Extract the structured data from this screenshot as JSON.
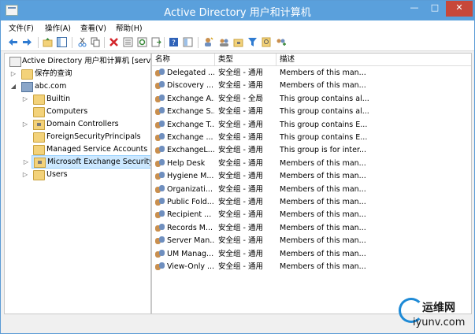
{
  "window": {
    "title": "Active Directory 用户和计算机",
    "controls": {
      "minimize": "—",
      "maximize": "□",
      "close": "✕"
    }
  },
  "menubar": {
    "items": [
      "文件(F)",
      "操作(A)",
      "查看(V)",
      "帮助(H)"
    ]
  },
  "toolbar": {
    "icons": [
      "back-icon",
      "forward-icon",
      "up-level-icon",
      "show-console-tree-icon",
      "cut-icon",
      "copy-icon",
      "delete-icon",
      "properties-icon",
      "refresh-icon",
      "export-list-icon",
      "help-icon",
      "help-topics-icon",
      "new-user-icon",
      "new-group-icon",
      "new-ou-icon",
      "filter-icon",
      "find-icon",
      "add-to-group-icon"
    ],
    "colors": {
      "nav_arrow": "#2f7bd1",
      "delete": "#d3262b"
    }
  },
  "tree": {
    "items": [
      {
        "label": "Active Directory 用户和计算机 [serve",
        "icon": "aduc-icon",
        "arrow": ""
      },
      {
        "label": "保存的查询",
        "icon": "folder-icon",
        "arrow": "▷"
      },
      {
        "label": "abc.com",
        "icon": "domain-icon",
        "arrow": "◢"
      },
      {
        "label": "Builtin",
        "icon": "folder-icon",
        "arrow": "▷"
      },
      {
        "label": "Computers",
        "icon": "folder-icon",
        "arrow": ""
      },
      {
        "label": "Domain Controllers",
        "icon": "ou-icon",
        "arrow": "▷"
      },
      {
        "label": "ForeignSecurityPrincipals",
        "icon": "folder-icon",
        "arrow": ""
      },
      {
        "label": "Managed Service Accounts",
        "icon": "folder-icon",
        "arrow": ""
      },
      {
        "label": "Microsoft Exchange Security",
        "icon": "ou-icon",
        "arrow": "▷",
        "selected": true
      },
      {
        "label": "Users",
        "icon": "folder-icon",
        "arrow": "▷"
      }
    ]
  },
  "list": {
    "columns": [
      "名称",
      "类型",
      "描述"
    ],
    "rows": [
      {
        "name": "Delegated ...",
        "type": "安全组 - 通用",
        "desc": "Members of this man..."
      },
      {
        "name": "Discovery ...",
        "type": "安全组 - 通用",
        "desc": "Members of this man..."
      },
      {
        "name": "Exchange A...",
        "type": "安全组 - 全局",
        "desc": "This group contains al..."
      },
      {
        "name": "Exchange S...",
        "type": "安全组 - 通用",
        "desc": "This group contains al..."
      },
      {
        "name": "Exchange T...",
        "type": "安全组 - 通用",
        "desc": "This group contains E..."
      },
      {
        "name": "Exchange ...",
        "type": "安全组 - 通用",
        "desc": "This group contains E..."
      },
      {
        "name": "ExchangeL...",
        "type": "安全组 - 通用",
        "desc": "This group is for inter..."
      },
      {
        "name": "Help Desk",
        "type": "安全组 - 通用",
        "desc": "Members of this man..."
      },
      {
        "name": "Hygiene M...",
        "type": "安全组 - 通用",
        "desc": "Members of this man..."
      },
      {
        "name": "Organizati...",
        "type": "安全组 - 通用",
        "desc": "Members of this man..."
      },
      {
        "name": "Public Fold...",
        "type": "安全组 - 通用",
        "desc": "Members of this man..."
      },
      {
        "name": "Recipient ...",
        "type": "安全组 - 通用",
        "desc": "Members of this man..."
      },
      {
        "name": "Records M...",
        "type": "安全组 - 通用",
        "desc": "Members of this man..."
      },
      {
        "name": "Server Man...",
        "type": "安全组 - 通用",
        "desc": "Members of this man..."
      },
      {
        "name": "UM Manag...",
        "type": "安全组 - 通用",
        "desc": "Members of this man..."
      },
      {
        "name": "View-Only ...",
        "type": "安全组 - 通用",
        "desc": "Members of this man..."
      }
    ]
  },
  "watermark": {
    "line1": "运维网",
    "line2": "iyunv.com"
  },
  "colors": {
    "titlebar": "#5aa0dc",
    "selection": "#cce8ff",
    "close_button": "#c7483a"
  }
}
